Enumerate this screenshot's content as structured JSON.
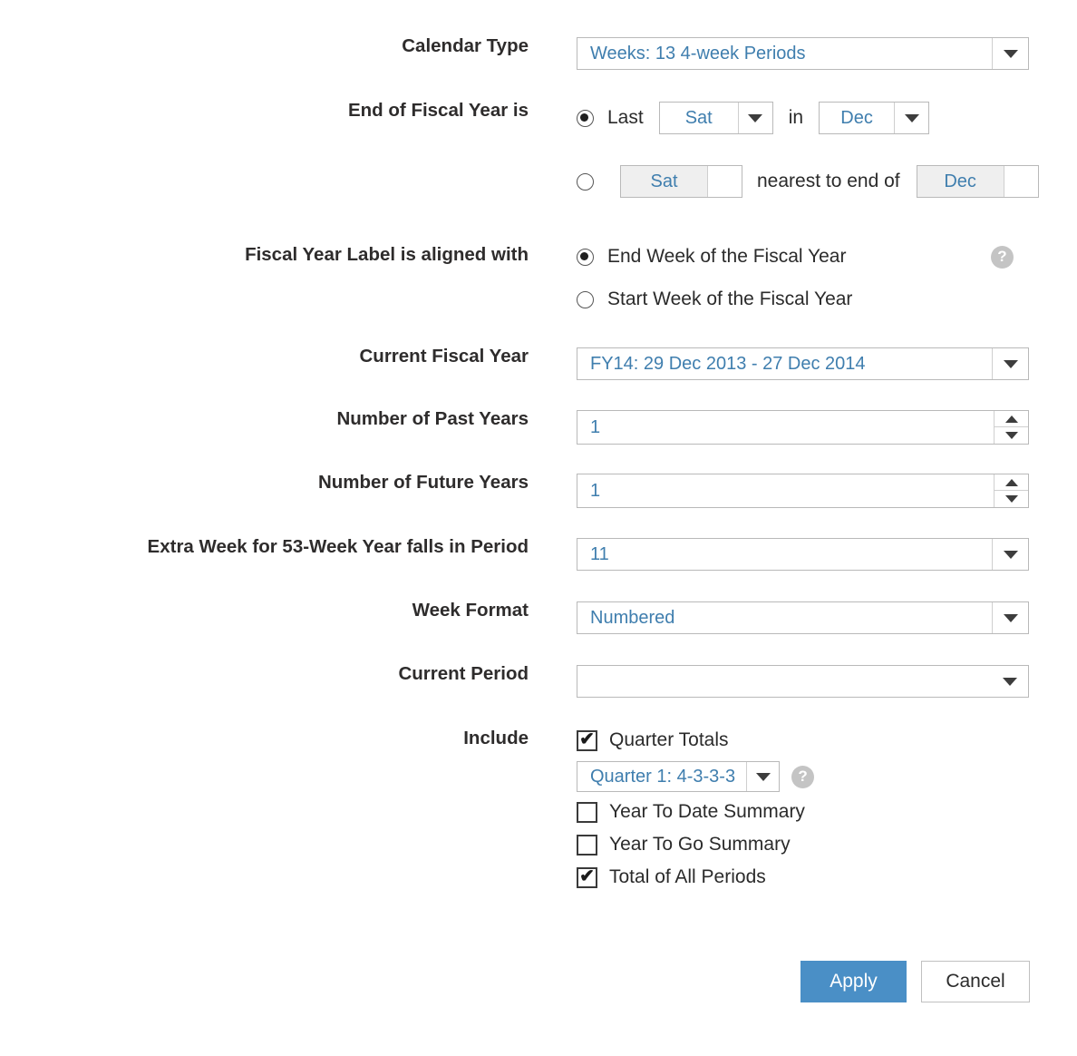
{
  "colors": {
    "value_blue": "#3f7eae",
    "apply_blue": "#4a8fc6",
    "label_dark": "#2e2c2c",
    "border_grey": "#b9b9b9",
    "disabled_grey": "#efefef",
    "help_grey": "#c4c4c4"
  },
  "labels": {
    "calendar_type": "Calendar Type",
    "end_of_fiscal_year": "End of Fiscal Year is",
    "fiscal_year_label": "Fiscal Year Label is aligned with",
    "current_fiscal_year": "Current Fiscal Year",
    "number_of_past_years": "Number of Past Years",
    "number_of_future_years": "Number of Future Years",
    "extra_week": "Extra Week for 53-Week Year falls in Period",
    "week_format": "Week Format",
    "current_period": "Current Period",
    "include": "Include"
  },
  "calendar_type": {
    "value": "Weeks: 13 4-week Periods"
  },
  "end_of_fiscal_year": {
    "mode": "last",
    "last": {
      "prefix": "Last",
      "weekday": "Sat",
      "joiner": "in",
      "month": "Dec",
      "selected": true
    },
    "nearest": {
      "weekday": "Sat",
      "middle_text": "nearest to end of",
      "month": "Dec",
      "selected": false,
      "disabled": true
    }
  },
  "fiscal_year_label": {
    "options": [
      {
        "label": "End Week of the Fiscal Year",
        "selected": true
      },
      {
        "label": "Start Week of the Fiscal Year",
        "selected": false
      }
    ],
    "help": "?"
  },
  "current_fiscal_year": {
    "value": "FY14: 29 Dec 2013 - 27 Dec 2014"
  },
  "number_of_past_years": {
    "value": "1"
  },
  "number_of_future_years": {
    "value": "1"
  },
  "extra_week": {
    "value": "11"
  },
  "week_format": {
    "value": "Numbered"
  },
  "current_period": {
    "value": ""
  },
  "include": {
    "quarter_totals": {
      "label": "Quarter Totals",
      "checked": true
    },
    "quarter_pattern": {
      "value": "Quarter 1: 4-3-3-3",
      "help": "?"
    },
    "year_to_date": {
      "label": "Year To Date Summary",
      "checked": false
    },
    "year_to_go": {
      "label": "Year To Go Summary",
      "checked": false
    },
    "total_all_periods": {
      "label": "Total of All Periods",
      "checked": true
    }
  },
  "footer": {
    "apply": "Apply",
    "cancel": "Cancel"
  },
  "glyphs": {
    "tick": "✔",
    "question": "?"
  }
}
